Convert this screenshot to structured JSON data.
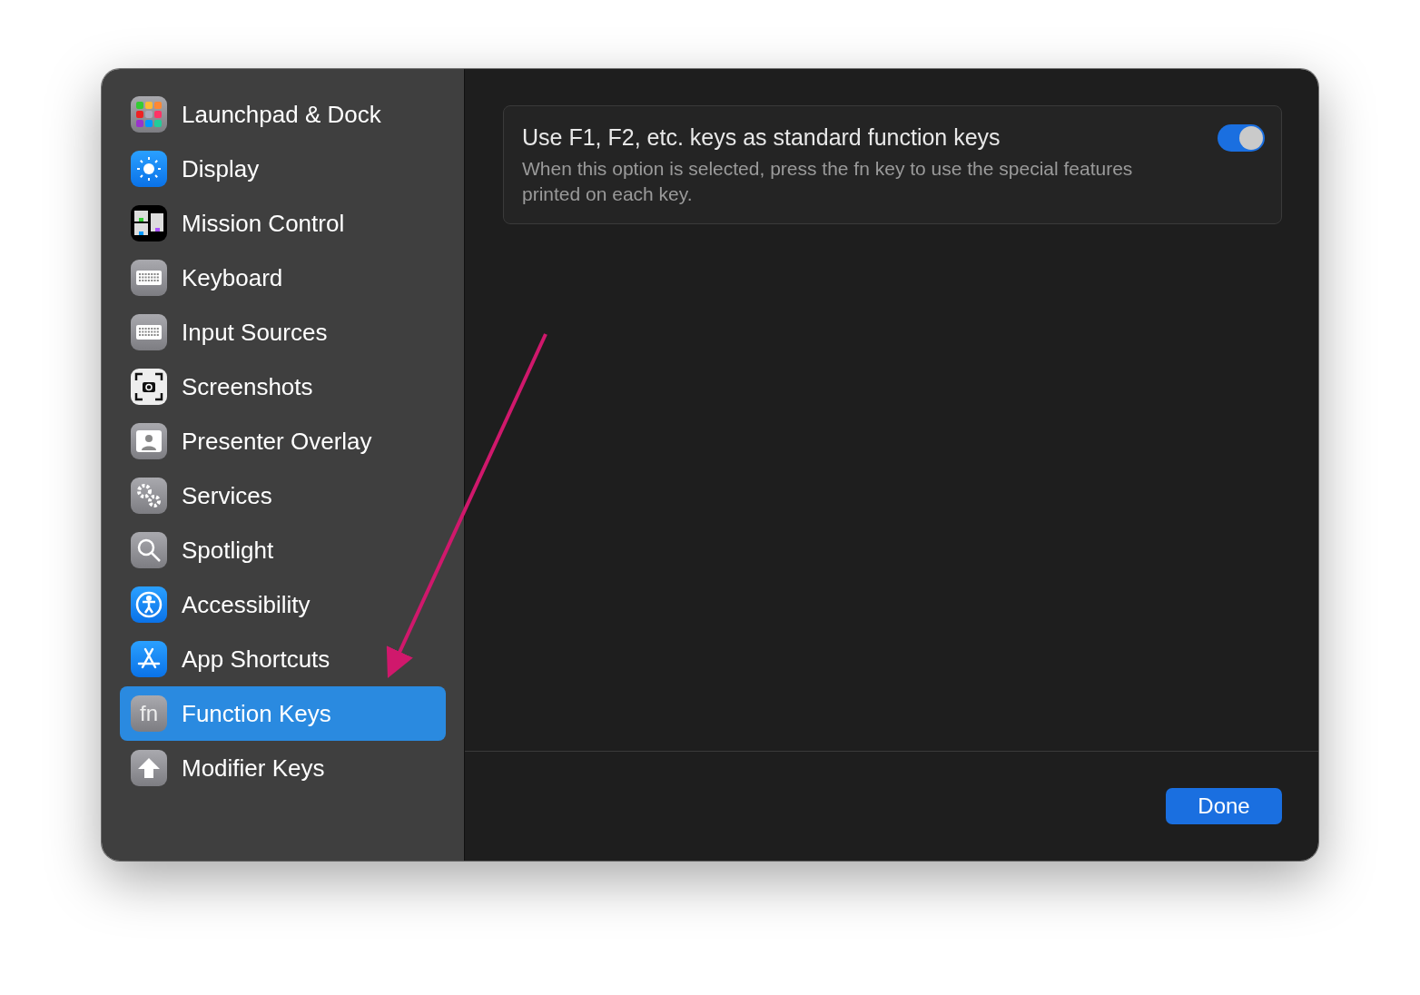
{
  "sidebar": {
    "items": [
      {
        "label": "Launchpad & Dock",
        "kind": "launchpad",
        "selected": false
      },
      {
        "label": "Display",
        "kind": "display",
        "selected": false
      },
      {
        "label": "Mission Control",
        "kind": "mission",
        "selected": false
      },
      {
        "label": "Keyboard",
        "kind": "keyboard",
        "selected": false
      },
      {
        "label": "Input Sources",
        "kind": "keyboard",
        "selected": false
      },
      {
        "label": "Screenshots",
        "kind": "screenshot",
        "selected": false
      },
      {
        "label": "Presenter Overlay",
        "kind": "presenter",
        "selected": false
      },
      {
        "label": "Services",
        "kind": "gears",
        "selected": false
      },
      {
        "label": "Spotlight",
        "kind": "search",
        "selected": false
      },
      {
        "label": "Accessibility",
        "kind": "accessibility",
        "selected": false
      },
      {
        "label": "App Shortcuts",
        "kind": "appstore",
        "selected": false
      },
      {
        "label": "Function Keys",
        "kind": "fn",
        "icon_text": "fn",
        "selected": true
      },
      {
        "label": "Modifier Keys",
        "kind": "arrow",
        "selected": false
      }
    ]
  },
  "setting": {
    "title": "Use F1, F2, etc. keys as standard function keys",
    "description": "When this option is selected, press the fn key to use the special features printed on each key.",
    "on": true
  },
  "footer": {
    "button": "Done"
  }
}
